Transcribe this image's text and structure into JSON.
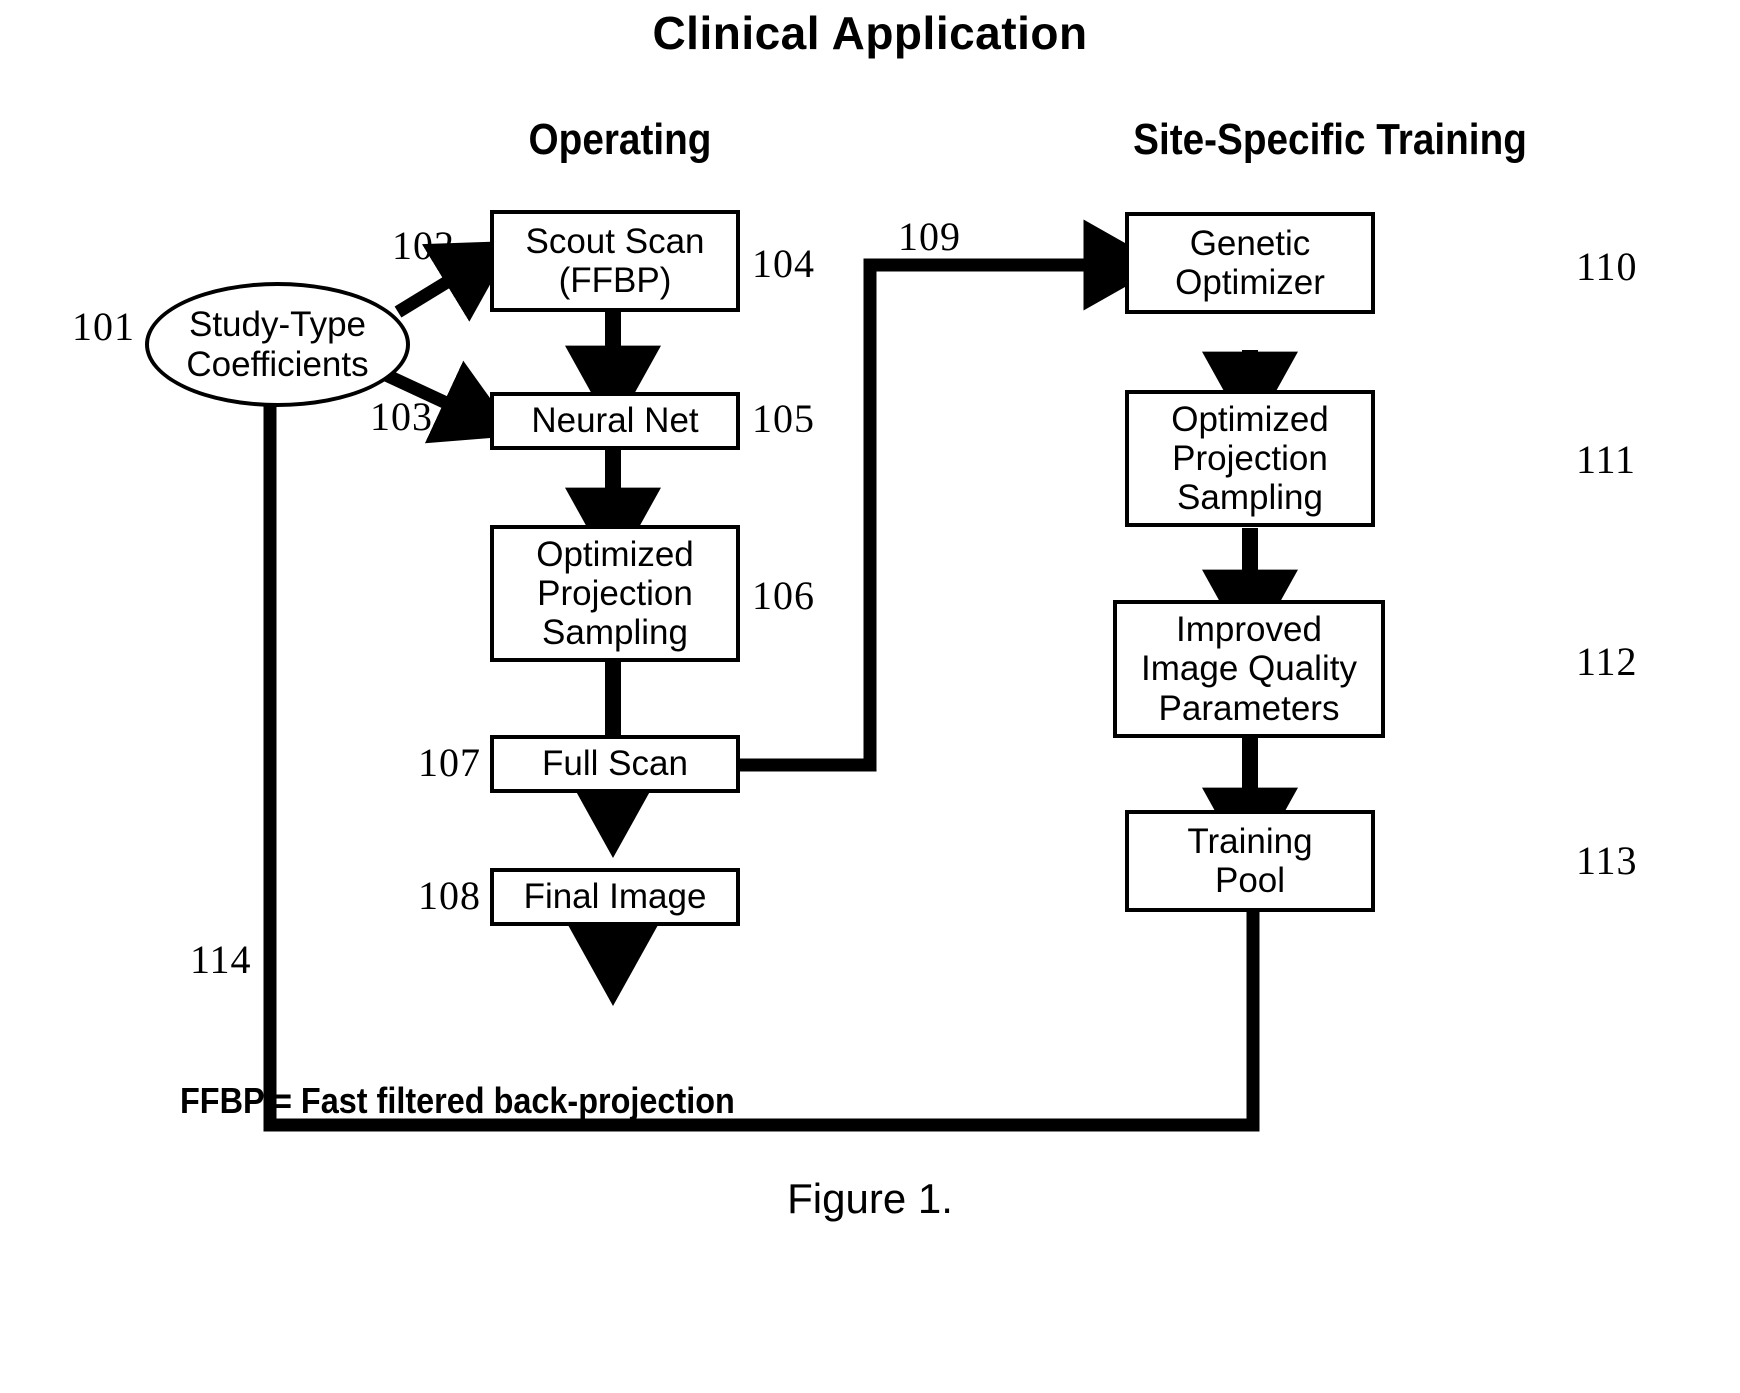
{
  "title": "Clinical Application",
  "columns": {
    "operating": "Operating",
    "training": "Site-Specific Training"
  },
  "nodes": {
    "study_type": {
      "label": "Study-Type\nCoefficients",
      "ref": "101"
    },
    "scout_scan": {
      "label": "Scout Scan\n(FFBP)",
      "ref": "104"
    },
    "neural_net": {
      "label": "Neural Net",
      "ref": "105"
    },
    "optimized_projection_sampling_left": {
      "label": "Optimized\nProjection\nSampling",
      "ref": "106"
    },
    "full_scan": {
      "label": "Full Scan",
      "ref": "107"
    },
    "final_image": {
      "label": "Final Image",
      "ref": "108"
    },
    "genetic_optimizer": {
      "label": "Genetic\nOptimizer",
      "ref": "110"
    },
    "optimized_projection_sampling_right": {
      "label": "Optimized\nProjection\nSampling",
      "ref": "111"
    },
    "improved_iq_params": {
      "label": "Improved\nImage Quality\nParameters",
      "ref": "112"
    },
    "training_pool": {
      "label": "Training\nPool",
      "ref": "113"
    }
  },
  "edges": {
    "study_to_scout": "102",
    "study_to_neural": "103",
    "fullscan_to_genetic": "109",
    "pool_to_study": "114"
  },
  "legend": "FFBP = Fast filtered back-projection",
  "figure_label": "Figure 1.",
  "colors": {
    "ink": "#000000",
    "paper": "#ffffff"
  }
}
